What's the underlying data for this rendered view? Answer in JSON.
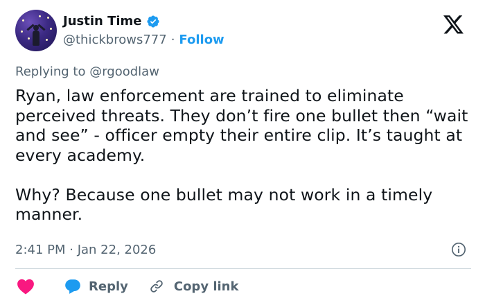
{
  "author": {
    "display_name": "Justin Time",
    "handle": "@thickbrows777",
    "separator": "·",
    "follow_label": "Follow",
    "verified": true
  },
  "reply_context": {
    "prefix": "Replying to",
    "mention": "@rgoodlaw"
  },
  "tweet": {
    "paragraph_1": "Ryan, law enforcement are trained to eliminate perceived threats. They don’t fire one bullet then “wait and see” - officer empty their entire clip. It’s taught at every academy.",
    "paragraph_2": "Why? Because one bullet may not work in a timely manner."
  },
  "timestamp": "2:41 PM · Jan 22, 2026",
  "actions": {
    "reply_label": "Reply",
    "copy_link_label": "Copy link"
  },
  "icons": {
    "brand": "x-logo-icon",
    "verified": "verified-badge-icon",
    "info": "info-icon",
    "like": "heart-icon",
    "reply": "speech-bubble-icon",
    "copy": "link-icon"
  },
  "colors": {
    "accent": "#1d9bf0",
    "like": "#f91880",
    "text_primary": "#0f1419",
    "text_secondary": "#536471",
    "divider": "#cfd9de"
  }
}
